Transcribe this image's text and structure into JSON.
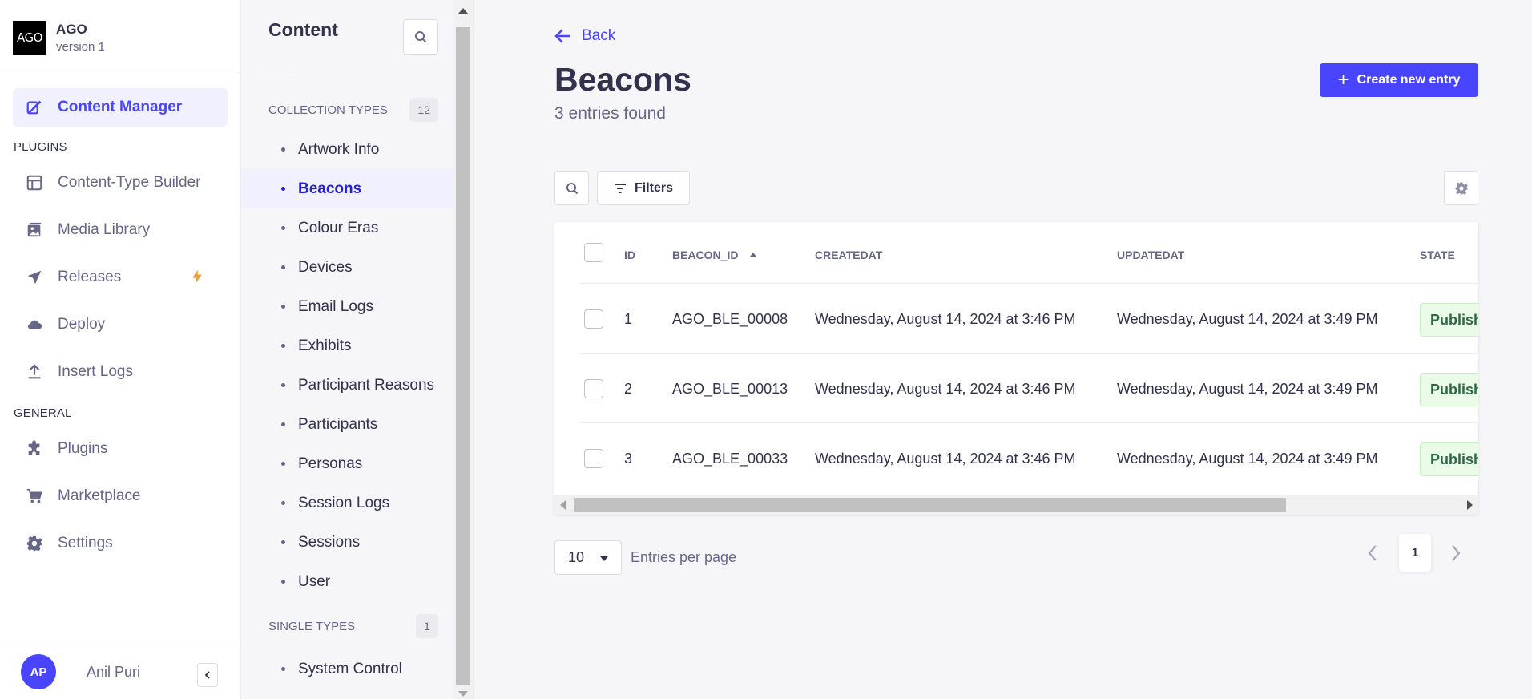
{
  "brand": {
    "logo_text": "AGO",
    "name": "AGO",
    "version": "version 1"
  },
  "mainnav": {
    "items_top": [
      {
        "label": "Content Manager",
        "icon": "feather-icon",
        "active": true
      }
    ],
    "section_plugins": "PLUGINS",
    "plugins": [
      {
        "label": "Content-Type Builder",
        "icon": "layout-icon"
      },
      {
        "label": "Media Library",
        "icon": "image-icon"
      },
      {
        "label": "Releases",
        "icon": "paper-plane-icon",
        "badge_icon": "lightning-icon",
        "badge_color": "#f29d41"
      },
      {
        "label": "Deploy",
        "icon": "cloud-icon"
      },
      {
        "label": "Insert Logs",
        "icon": "upload-icon"
      }
    ],
    "section_general": "GENERAL",
    "general": [
      {
        "label": "Plugins",
        "icon": "puzzle-icon"
      },
      {
        "label": "Marketplace",
        "icon": "cart-icon"
      },
      {
        "label": "Settings",
        "icon": "gear-icon"
      }
    ],
    "user": {
      "initials": "AP",
      "name": "Anil Puri"
    }
  },
  "subnav": {
    "title": "Content",
    "collection_title": "COLLECTION TYPES",
    "collection_count": "12",
    "collection_types": [
      "Artwork Info",
      "Beacons",
      "Colour Eras",
      "Devices",
      "Email Logs",
      "Exhibits",
      "Participant Reasons",
      "Participants",
      "Personas",
      "Session Logs",
      "Sessions",
      "User"
    ],
    "active_type": "Beacons",
    "single_title": "SINGLE TYPES",
    "single_count": "1",
    "single_types": [
      "System Control"
    ]
  },
  "page": {
    "back_label": "Back",
    "title": "Beacons",
    "subtitle": "3 entries found",
    "create_label": "Create new entry",
    "filters_label": "Filters"
  },
  "table": {
    "headers": {
      "id": "ID",
      "beacon_id": "BEACON_ID",
      "created": "CREATEDAT",
      "updated": "UPDATEDAT",
      "state": "STATE"
    },
    "rows": [
      {
        "id": "1",
        "beacon_id": "AGO_BLE_00008",
        "created": "Wednesday, August 14, 2024 at 3:46 PM",
        "updated": "Wednesday, August 14, 2024 at 3:49 PM",
        "state": "Published"
      },
      {
        "id": "2",
        "beacon_id": "AGO_BLE_00013",
        "created": "Wednesday, August 14, 2024 at 3:46 PM",
        "updated": "Wednesday, August 14, 2024 at 3:49 PM",
        "state": "Published"
      },
      {
        "id": "3",
        "beacon_id": "AGO_BLE_00033",
        "created": "Wednesday, August 14, 2024 at 3:46 PM",
        "updated": "Wednesday, August 14, 2024 at 3:49 PM",
        "state": "Published"
      }
    ]
  },
  "pagination": {
    "per_page": "10",
    "per_page_label": "Entries per page",
    "current_page": "1"
  },
  "colors": {
    "primary": "#4945ff",
    "active_bg": "#f0f0ff",
    "published_bg": "#eafbe7",
    "published_text": "#2f6846"
  }
}
